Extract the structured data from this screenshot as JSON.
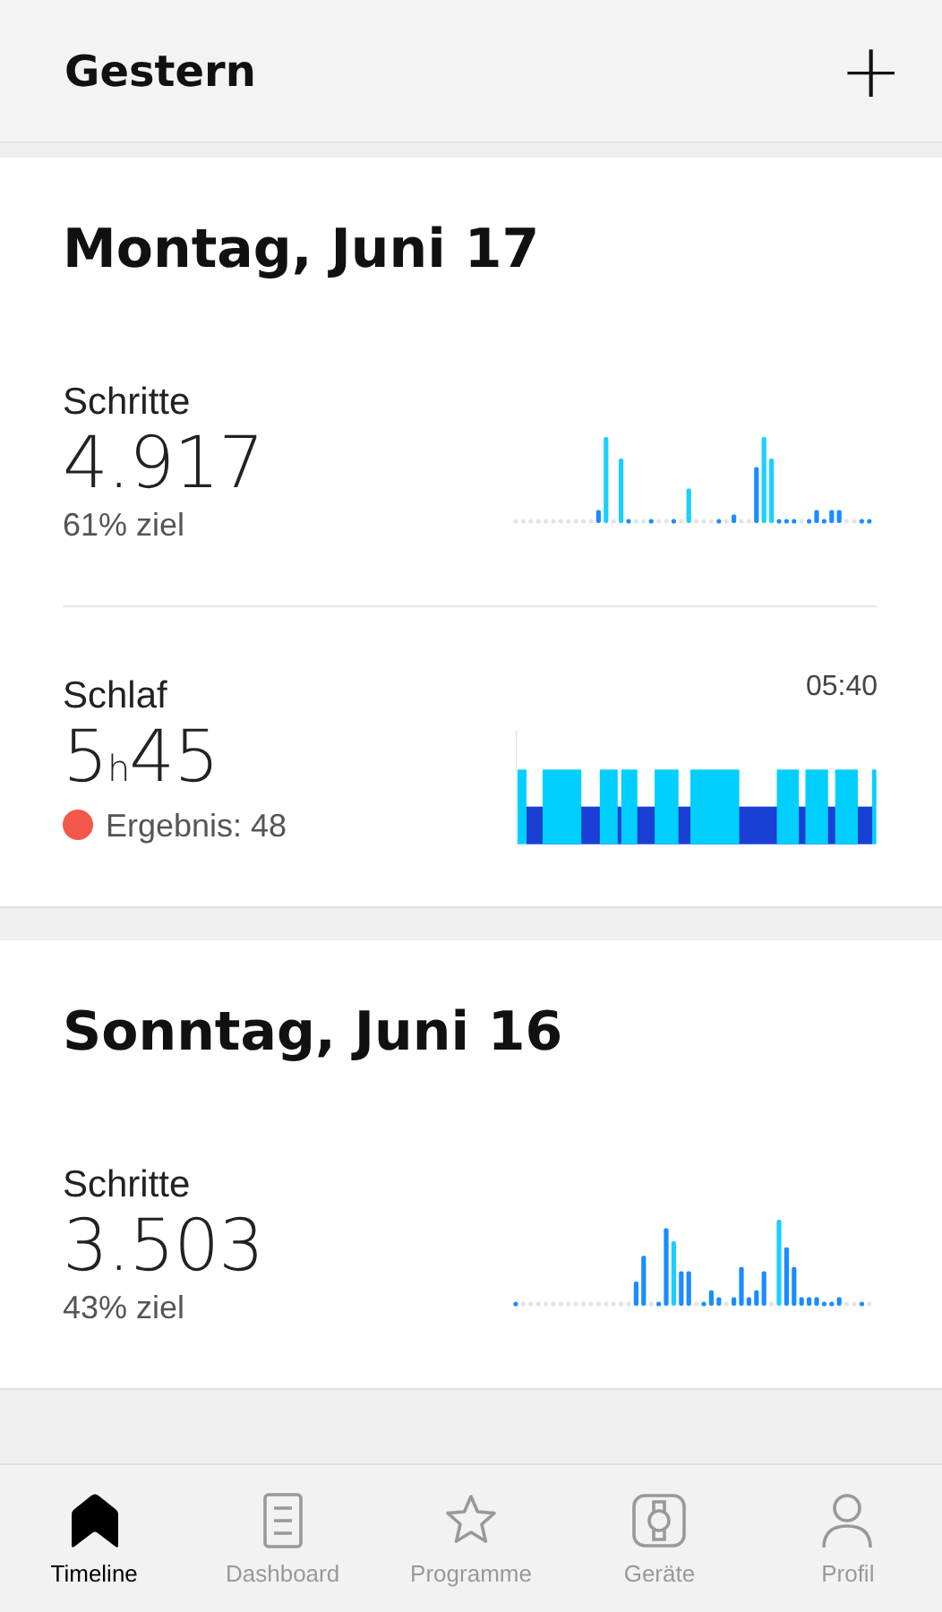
{
  "header": {
    "title": "Gestern",
    "add_label": "+"
  },
  "days": [
    {
      "title": "Montag, Juni 17",
      "metrics": [
        {
          "kind": "steps",
          "label": "Schritte",
          "value": "4.917",
          "goal": "61% ziel"
        },
        {
          "kind": "sleep",
          "label": "Schlaf",
          "value": "5$_{h}$45",
          "time": "05:40",
          "score": "Ergebnis: 48",
          "color": "#f4584a"
        }
      ]
    },
    {
      "title": "Sonntag, Juni 16",
      "metrics": [
        {
          "kind": "steps",
          "label": "Schritte",
          "value": "3.503",
          "goal": "43% ziel"
        }
      ]
    }
  ],
  "nav": [
    {
      "label": "Timeline",
      "selected": true
    },
    {
      "label": "Dashboard",
      "selected": false
    },
    {
      "label": "Programme",
      "selected": false
    },
    {
      "label": "Geräte",
      "selected": false
    },
    {
      "label": "Profil",
      "selected": false
    }
  ]
}
